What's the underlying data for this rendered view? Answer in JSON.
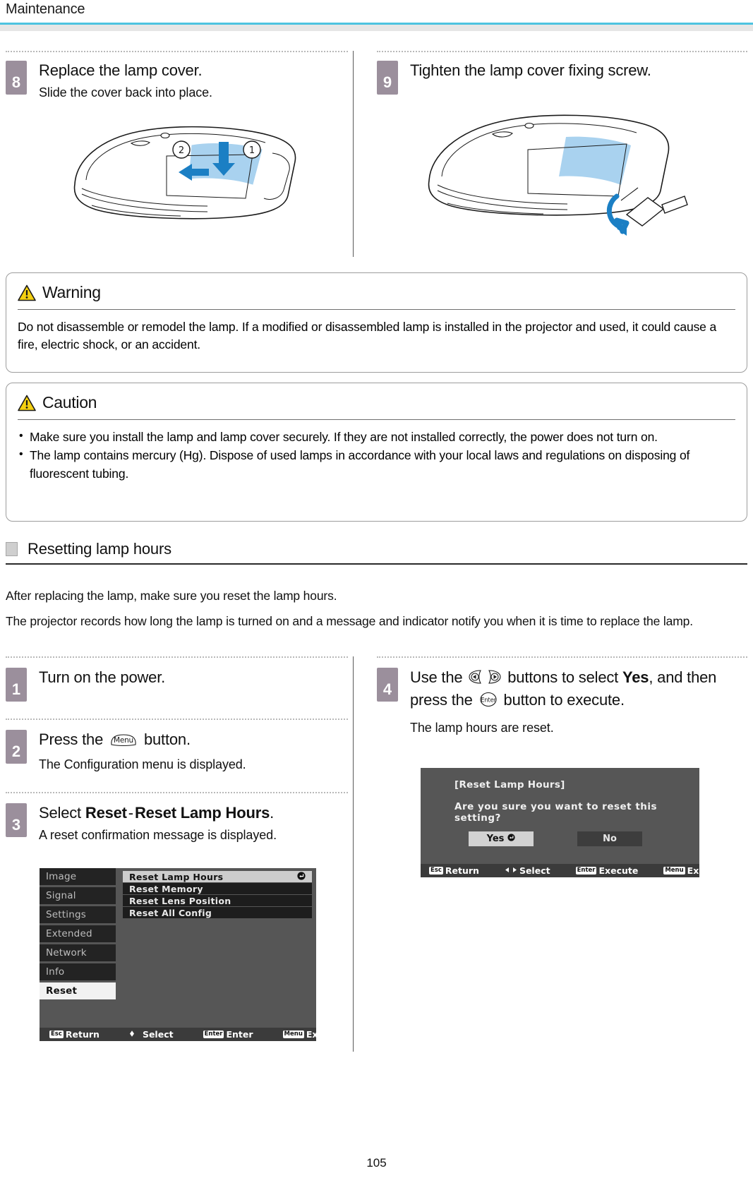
{
  "header": {
    "title": "Maintenance"
  },
  "page_number": "105",
  "steps_top": [
    {
      "num": "8",
      "title": "Replace the lamp cover.",
      "sub": "Slide the cover back into place.",
      "callouts": [
        "②",
        "①"
      ]
    },
    {
      "num": "9",
      "title": "Tighten the lamp cover fixing screw.",
      "sub": ""
    }
  ],
  "warning": {
    "icon": "warning-triangle-icon",
    "label": "Warning",
    "body": "Do not disassemble or remodel the lamp. If a modified or disassembled lamp is installed in the projector and used, it could cause a fire, electric shock, or an accident."
  },
  "caution": {
    "icon": "warning-triangle-icon",
    "label": "Caution",
    "bullets": [
      "Make sure you install the lamp and lamp cover securely. If they are not installed correctly, the power does not turn on.",
      "The lamp contains mercury (Hg). Dispose of used lamps in accordance with your local laws and regulations on disposing of fluorescent tubing."
    ]
  },
  "section": {
    "icon": "section-square-icon",
    "title": "Resetting lamp hours",
    "intro1": "After replacing the lamp, make sure you reset the lamp hours.",
    "intro2": "The projector records how long the lamp is turned on and a message and indicator notify you when it is time to replace the lamp."
  },
  "steps_reset": {
    "step1": {
      "num": "1",
      "title": "Turn on the power."
    },
    "step2": {
      "num": "2",
      "title_pre": "Press the",
      "key": "Menu",
      "title_post": "button.",
      "sub": "The Configuration menu is displayed."
    },
    "step3": {
      "num": "3",
      "title_pre": "Select",
      "bold1": "Reset",
      "dash": "-",
      "bold2": "Reset Lamp Hours",
      "title_post": ".",
      "sub": "A reset confirmation message is displayed."
    },
    "step4": {
      "num": "4",
      "t1": "Use the",
      "key_left": "left-arrow-key",
      "key_right": "right-arrow-key",
      "t2": "buttons to select",
      "bold_yes": "Yes",
      "t3": ", and then press the",
      "key_enter": "Enter",
      "t4": "button to execute.",
      "sub": "The lamp hours are reset."
    }
  },
  "osd_menu": {
    "tabs": [
      {
        "label": "Image",
        "active": false
      },
      {
        "label": "Signal",
        "active": false
      },
      {
        "label": "Settings",
        "active": false
      },
      {
        "label": "Extended",
        "active": false
      },
      {
        "label": "Network",
        "active": false
      },
      {
        "label": "Info",
        "active": false
      },
      {
        "label": "Reset",
        "active": true
      }
    ],
    "items": [
      {
        "label": "Reset Lamp Hours",
        "selected": true,
        "marker": "↵"
      },
      {
        "label": "Reset Memory",
        "selected": false,
        "marker": ""
      },
      {
        "label": "Reset Lens Position",
        "selected": false,
        "marker": ""
      },
      {
        "label": "Reset All Config",
        "selected": false,
        "marker": ""
      }
    ],
    "footer": [
      {
        "key": "Esc",
        "label": "Return"
      },
      {
        "key": "arrows-updown",
        "label": "Select"
      },
      {
        "key": "Enter",
        "label": "Enter"
      },
      {
        "key": "Menu",
        "label": "Exit"
      }
    ]
  },
  "osd_dialog": {
    "title": "[Reset Lamp Hours]",
    "message": "Are you sure you want to reset this setting?",
    "buttons": [
      {
        "label": "Yes",
        "selected": true,
        "marker": "↵"
      },
      {
        "label": "No",
        "selected": false,
        "marker": ""
      }
    ],
    "footer": [
      {
        "key": "Esc",
        "label": "Return"
      },
      {
        "key": "arrows-leftright",
        "label": "Select"
      },
      {
        "key": "Enter",
        "label": "Execute"
      },
      {
        "key": "Menu",
        "label": "Exit"
      }
    ]
  },
  "colors": {
    "accent_cyan": "#4ec3e0",
    "step_badge": "#9b8f9c",
    "warn_yellow": "#f5d010",
    "illustration_blue": "#a9d2ef",
    "arrow_blue": "#1b7fc4"
  }
}
